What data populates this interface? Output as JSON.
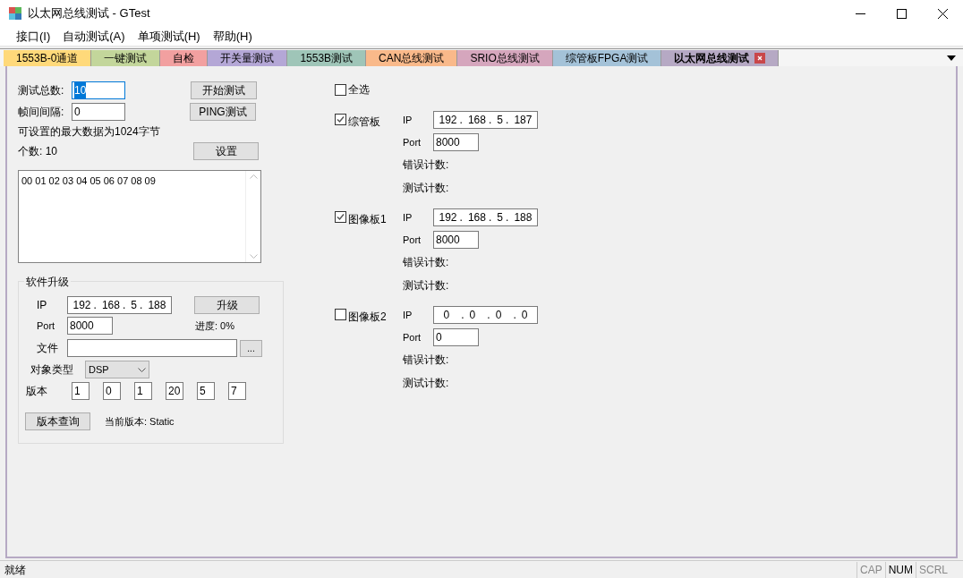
{
  "window": {
    "title": "以太网总线测试 - GTest"
  },
  "menu": [
    "接口(I)",
    "自动测试(A)",
    "单项测试(H)",
    "帮助(H)"
  ],
  "tabs": [
    {
      "label": "1553B-0通道",
      "selected": false,
      "color": "#ffd97a"
    },
    {
      "label": "一键测试",
      "selected": false,
      "color": "#c3d69b"
    },
    {
      "label": "自检",
      "selected": false,
      "color": "#f2a0a0"
    },
    {
      "label": "开关量测试",
      "selected": false,
      "color": "#b4a7d6"
    },
    {
      "label": "1553B测试",
      "selected": false,
      "color": "#9fc5b8"
    },
    {
      "label": "CAN总线测试",
      "selected": false,
      "color": "#f9b98a"
    },
    {
      "label": "SRIO总线测试",
      "selected": false,
      "color": "#d5a6bd"
    },
    {
      "label": "综管板FPGA测试",
      "selected": false,
      "color": "#a4c2d8"
    },
    {
      "label": "以太网总线测试",
      "selected": true,
      "color": "#b6a9c4"
    }
  ],
  "test": {
    "total_label": "测试总数:",
    "total_value": "10",
    "total_text_selected": true,
    "interval_label": "帧间间隔:",
    "interval_value": "0",
    "start_button": "开始测试",
    "ping_button": "PING测试",
    "note": "可设置的最大数据为1024字节",
    "count_label": "个数: 10",
    "set_button": "设置",
    "data": "00 01 02 03 04 05 06 07 08 09"
  },
  "upgrade": {
    "title": "软件升级",
    "ip_label": "IP",
    "ip": [
      "192",
      "168",
      "5",
      "188"
    ],
    "ip_separator": ".",
    "upgrade_button": "升级",
    "port_label": "Port",
    "port": "8000",
    "progress": "进度: 0%",
    "file_label": "文件",
    "browse_button": "...",
    "type_label": "对象类型",
    "type_value": "DSP",
    "version_label": "版本",
    "version": [
      "1",
      "0",
      "1",
      "20",
      "5",
      "7"
    ],
    "query_button": "版本查询",
    "current_version": "当前版本: Static"
  },
  "select_all": {
    "label": "全选",
    "checked": false
  },
  "boards": [
    {
      "name": "综管板",
      "checked": true,
      "ip_label": "IP",
      "ip": [
        "192",
        "168",
        "5",
        "187"
      ],
      "ip_separator": ".",
      "port_label": "Port",
      "port": "8000",
      "error_label": "错误计数:",
      "test_label": "测试计数:"
    },
    {
      "name": "图像板1",
      "checked": true,
      "ip_label": "IP",
      "ip": [
        "192",
        "168",
        "5",
        "188"
      ],
      "ip_separator": ".",
      "port_label": "Port",
      "port": "8000",
      "error_label": "错误计数:",
      "test_label": "测试计数:"
    },
    {
      "name": "图像板2",
      "checked": false,
      "ip_label": "IP",
      "ip": [
        "0",
        "0",
        "0",
        "0"
      ],
      "ip_separator": ".",
      "port_label": "Port",
      "port": "0",
      "error_label": "错误计数:",
      "test_label": "测试计数:"
    }
  ],
  "status_bar": {
    "text": "就绪",
    "indicators": [
      {
        "label": "CAP",
        "on": false
      },
      {
        "label": "NUM",
        "on": true
      },
      {
        "label": "SCRL",
        "on": false
      }
    ]
  }
}
